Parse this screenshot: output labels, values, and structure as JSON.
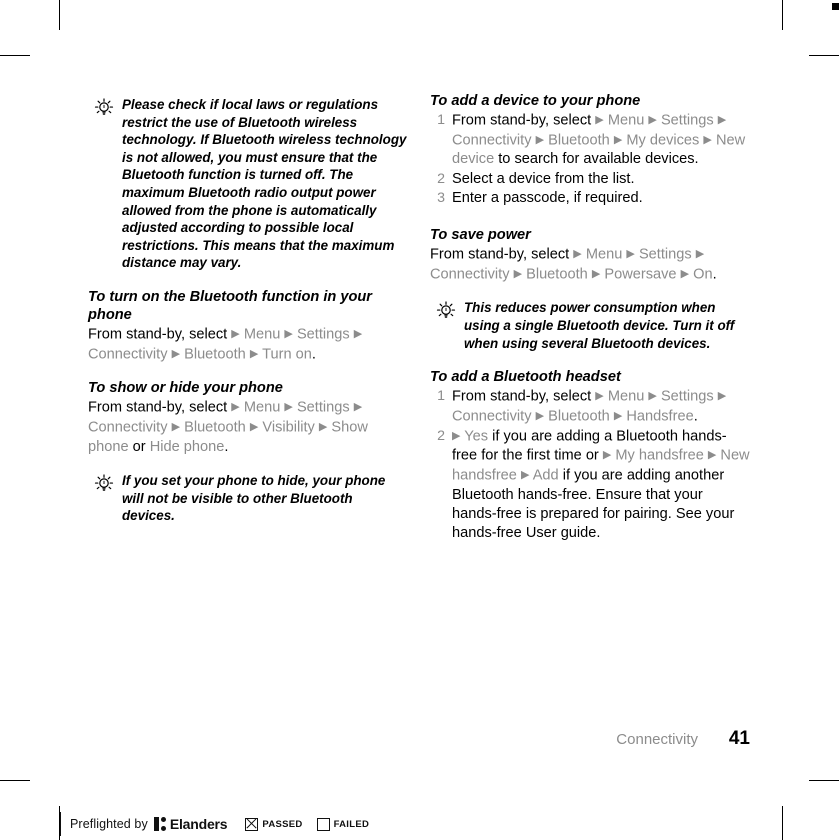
{
  "document": {
    "chapter": "Connectivity",
    "page_number": "41"
  },
  "left_column": {
    "tip_1": {
      "icon": "lightbulb-tip-icon",
      "text": "Please check if local laws or regulations restrict the use of Bluetooth wireless technology. If Bluetooth wireless technology is not allowed, you must ensure that the Bluetooth function is turned off. The maximum Bluetooth radio output power allowed from the phone is automatically adjusted according to possible local restrictions. This means that the maximum distance may vary."
    },
    "section_turn_on": {
      "heading": "To turn on the Bluetooth function in your phone",
      "lead": "From stand-by, select",
      "path": [
        "Menu",
        "Settings",
        "Connectivity",
        "Bluetooth",
        "Turn on"
      ],
      "trailing": "."
    },
    "section_show_hide": {
      "heading": "To show or hide your phone",
      "lead": "From stand-by, select",
      "path": [
        "Menu",
        "Settings",
        "Connectivity",
        "Bluetooth",
        "Visibility",
        "Show phone"
      ],
      "conjunction": "or",
      "path_alt": [
        "Hide phone"
      ],
      "trailing": "."
    },
    "tip_2": {
      "icon": "lightbulb-tip-icon",
      "text": "If you set your phone to hide, your phone will not be visible to other Bluetooth devices."
    }
  },
  "right_column": {
    "section_add_device": {
      "heading": "To add a device to your phone",
      "steps": [
        {
          "number": "1",
          "lead": "From stand-by, select",
          "path": [
            "Menu",
            "Settings",
            "Connectivity",
            "Bluetooth",
            "My devices",
            "New device"
          ],
          "tail": "to search for available devices."
        },
        {
          "number": "2",
          "lead": "Select a device from the list.",
          "path": [],
          "tail": ""
        },
        {
          "number": "3",
          "lead": "Enter a passcode, if required.",
          "path": [],
          "tail": ""
        }
      ]
    },
    "section_save_power": {
      "heading": "To save power",
      "lead": "From stand-by, select",
      "path": [
        "Menu",
        "Settings",
        "Connectivity",
        "Bluetooth",
        "Powersave",
        "On"
      ],
      "trailing": "."
    },
    "tip_1": {
      "icon": "lightbulb-tip-icon",
      "text": "This reduces power consumption when using a single Bluetooth device. Turn it off when using several Bluetooth devices."
    },
    "section_add_headset": {
      "heading": "To add a Bluetooth headset",
      "step_1": {
        "number": "1",
        "lead": "From stand-by, select",
        "path": [
          "Menu",
          "Settings",
          "Connectivity",
          "Bluetooth",
          "Handsfree"
        ],
        "trailing": "."
      },
      "step_2": {
        "number": "2",
        "path_first": [
          "Yes"
        ],
        "mid_text": "if you are adding a Bluetooth hands-free for the first time or",
        "path_second": [
          "My handsfree",
          "New handsfree",
          "Add"
        ],
        "tail": "if you are adding another Bluetooth hands-free. Ensure that your hands-free is prepared for pairing. See your hands-free User guide."
      }
    }
  },
  "preflight": {
    "label": "Preflighted by",
    "brand": "Elanders",
    "passed_text": "PASSED",
    "failed_text": "FAILED",
    "passed_checked": true,
    "failed_checked": false
  },
  "colors": {
    "menu_term": "#8c8c8c",
    "body_text": "#000000",
    "chapter_label": "#8c8c8c"
  }
}
